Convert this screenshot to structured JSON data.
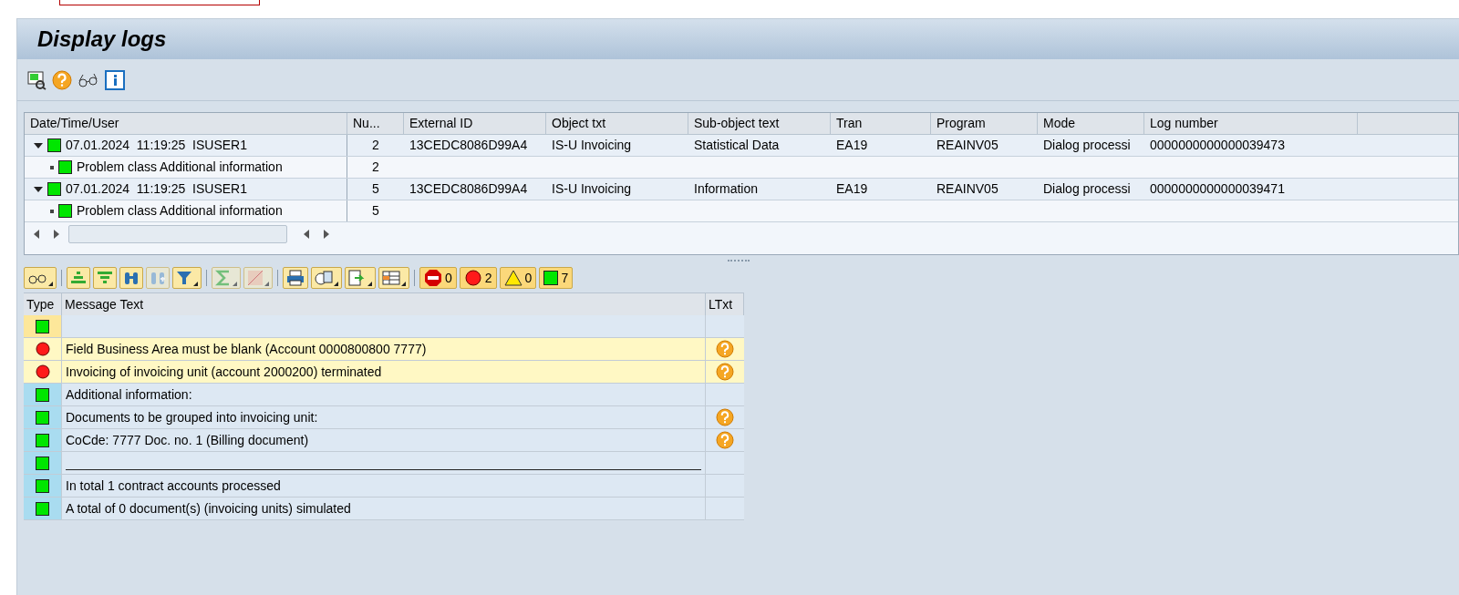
{
  "window": {
    "title": "Display logs"
  },
  "log_tree": {
    "columns": [
      "Date/Time/User",
      "Nu...",
      "External ID",
      "Object txt",
      "Sub-object text",
      "Tran",
      "Program",
      "Mode",
      "Log number"
    ],
    "rows": [
      {
        "date": "07.01.2024",
        "time": "11:19:25",
        "user": "ISUSER1",
        "count": "2",
        "external_id": "13CEDC8086D99A4",
        "object": "IS-U Invoicing",
        "subobject": "Statistical Data",
        "tran": "EA19",
        "program": "REAINV05",
        "mode": "Dialog processi",
        "log_number": "0000000000000039473",
        "expanded": true,
        "children": [
          {
            "text": "Problem class Additional information",
            "count": "2"
          }
        ]
      },
      {
        "date": "07.01.2024",
        "time": "11:19:25",
        "user": "ISUSER1",
        "count": "5",
        "external_id": "13CEDC8086D99A4",
        "object": "IS-U Invoicing",
        "subobject": "Information",
        "tran": "EA19",
        "program": "REAINV05",
        "mode": "Dialog processi",
        "log_number": "0000000000000039471",
        "expanded": true,
        "children": [
          {
            "text": "Problem class Additional information",
            "count": "5"
          }
        ]
      }
    ]
  },
  "counters": [
    {
      "kind": "stop",
      "count": "0"
    },
    {
      "kind": "error",
      "count": "2"
    },
    {
      "kind": "warning",
      "count": "0"
    },
    {
      "kind": "success",
      "count": "7"
    }
  ],
  "messages": {
    "columns": [
      "Type",
      "Message Text",
      "LTxt"
    ],
    "rows": [
      {
        "kind": "success",
        "text": "",
        "long_text": false,
        "selected": true
      },
      {
        "kind": "error",
        "text": "Field Business Area must be blank (Account 0000800800 7777)",
        "long_text": true,
        "selected": false
      },
      {
        "kind": "error",
        "text": "Invoicing of invoicing unit (account 2000200) terminated",
        "long_text": true,
        "selected": false
      },
      {
        "kind": "success",
        "text": "Additional information:",
        "long_text": false,
        "selected": false
      },
      {
        "kind": "success",
        "text": "Documents to be grouped into invoicing unit:",
        "long_text": true,
        "selected": false
      },
      {
        "kind": "success",
        "text": "CoCde: 7777 Doc. no. 1 (Billing document)",
        "long_text": true,
        "selected": false
      },
      {
        "kind": "separator",
        "text": "",
        "long_text": false,
        "selected": false
      },
      {
        "kind": "success",
        "text": "In total 1 contract accounts processed",
        "long_text": false,
        "selected": false
      },
      {
        "kind": "success",
        "text": "A total of 0 document(s) (invoicing units) simulated",
        "long_text": false,
        "selected": false
      }
    ]
  }
}
